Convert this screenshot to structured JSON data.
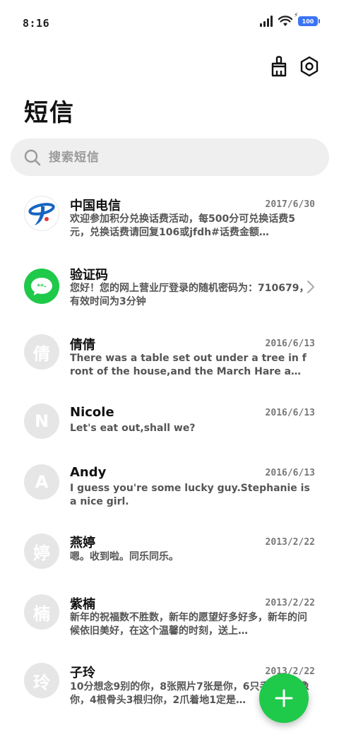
{
  "status_bar": {
    "time": "8:16",
    "battery": "100"
  },
  "toolbar": {
    "clean_icon": "broom-icon",
    "settings_icon": "settings-hex-icon"
  },
  "page": {
    "title": "短信"
  },
  "search": {
    "placeholder": "搜索短信",
    "value": ""
  },
  "colors": {
    "accent_green": "#1fc94a",
    "telecom_blue": "#1565c0",
    "avatar_gray": "#e6e6e6"
  },
  "messages": [
    {
      "name": "中国电信",
      "date": "2017/6/30",
      "preview": "欢迎参加积分兑换话费活动，每500分可兑换话费5元，兑换话费请回复106或jfdh#话费金额…",
      "avatar": "telecom-logo"
    },
    {
      "name": "验证码",
      "date": "",
      "preview": "您好！您的网上营业厅登录的随机密码为：710679，有效时间为3分钟",
      "avatar": "sms-bubble"
    },
    {
      "name": "倩倩",
      "date": "2016/6/13",
      "preview": "There was a table set out under a tree in front of the house,and the March Hare a…",
      "avatar_text": "倩"
    },
    {
      "name": "Nicole",
      "date": "2016/6/13",
      "preview": "Let's eat out,shall we?",
      "avatar_text": "N"
    },
    {
      "name": "Andy",
      "date": "2016/6/13",
      "preview": "I guess you're some lucky guy.Stephanie is a nice girl.",
      "avatar_text": "A"
    },
    {
      "name": "燕婷",
      "date": "2013/2/22",
      "preview": "嗯。收到啦。同乐同乐。",
      "avatar_text": "婷"
    },
    {
      "name": "紫楠",
      "date": "2013/2/22",
      "preview": "新年的祝福数不胜数，新年的愿望好多好多，新年的问候依旧美好，在这个温馨的时刻，送上…",
      "avatar_text": "楠"
    },
    {
      "name": "子玲",
      "date": "2013/2/22",
      "preview": "10分想念9别的你，8张照片7张是你，6只手机都是像你，4根骨头3根归你，2爪着地1定是…",
      "avatar_text": "玲"
    }
  ],
  "fab": {
    "icon": "plus-icon"
  }
}
